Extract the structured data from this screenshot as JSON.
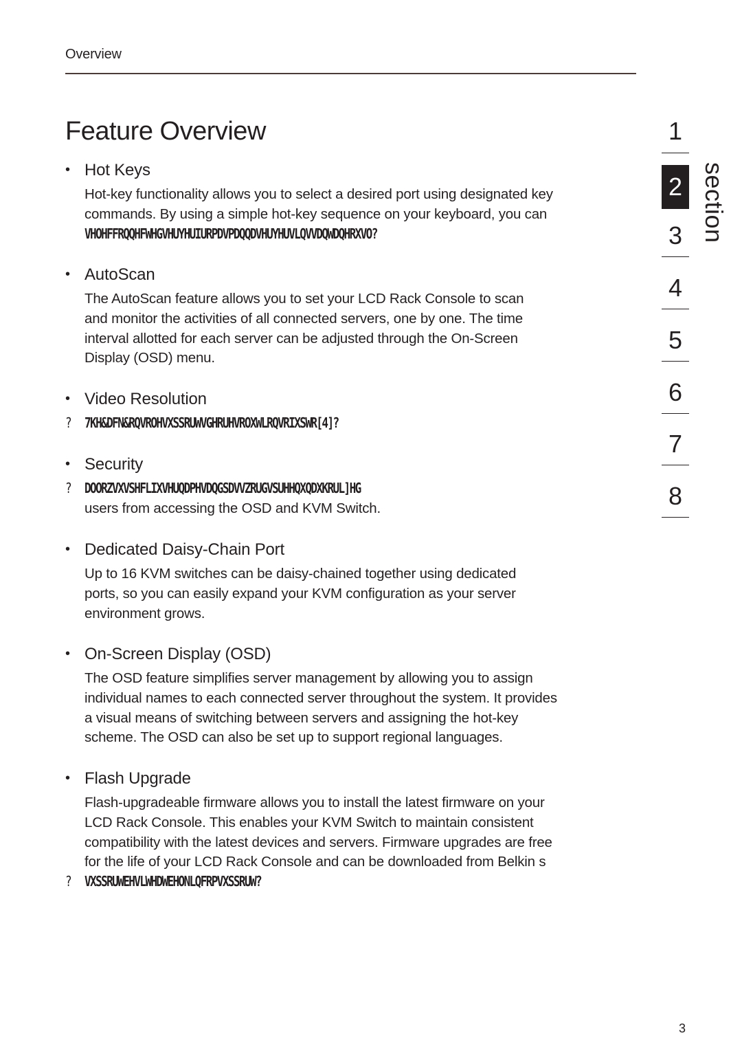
{
  "header": {
    "running_head": "Overview",
    "rule_color": "#4a3a38"
  },
  "page_title": "Feature Overview",
  "features": [
    {
      "title": "Hot Keys",
      "lines": [
        "Hot-key functionality allows you to select a desired port using designated key",
        "commands. By using a simple hot-key sequence on your keyboard, you can"
      ],
      "garbled_line": "VHOHFFRQQHFWHGVHUYHUIURPDVPDQQDVHUYHUVLQVVDQWDQHRXVO?"
    },
    {
      "title": "AutoScan",
      "lines": [
        "The AutoScan feature allows you to set your LCD Rack Console to scan",
        "and monitor the activities of all connected servers, one by one. The time",
        "interval allotted for each server can be adjusted through the On-Screen",
        "Display (OSD) menu."
      ]
    },
    {
      "title": "Video Resolution",
      "garbled_outdent": "7KH&DFN&RQVROHVXSSRUWVGHRUHVROXWLRQVRIXSWR[4]?",
      "garbled_prefix": "?"
    },
    {
      "title": "Security",
      "garbled_outdent": "DOORZVXVSHFLIXVHUQDPHVDQGSDVVZRUGVSUHHQXQDXKRUL]HG",
      "garbled_prefix": "?",
      "lines_after": [
        "users from accessing the OSD and KVM Switch."
      ]
    },
    {
      "title": "Dedicated Daisy-Chain Port",
      "lines": [
        "Up to 16 KVM switches can be daisy-chained together using dedicated",
        "ports, so you can easily expand your KVM configuration as your server",
        "environment grows."
      ]
    },
    {
      "title": "On-Screen Display (OSD)",
      "lines": [
        "The OSD feature simplifies server management by allowing you to assign",
        "individual names to each connected server throughout the system. It provides",
        "a visual means of switching between servers and assigning the hot-key",
        "scheme. The OSD can also be set up to support regional languages."
      ]
    },
    {
      "title": "Flash Upgrade",
      "lines": [
        "Flash-upgradeable firmware allows you to install the latest firmware on your",
        "LCD Rack Console. This enables your KVM Switch to maintain consistent",
        "compatibility with the latest devices and servers. Firmware upgrades are free",
        "for the life of your LCD Rack Console and can be downloaded from Belkin s"
      ],
      "garbled_outdent": "VXSSRUWEHVLWHDWEHONLQFRPVXSSRUW?",
      "garbled_prefix": "?"
    }
  ],
  "section_nav": {
    "label": "section",
    "items": [
      "1",
      "2",
      "3",
      "4",
      "5",
      "6",
      "7",
      "8"
    ],
    "active": "2"
  },
  "page_number": "3"
}
